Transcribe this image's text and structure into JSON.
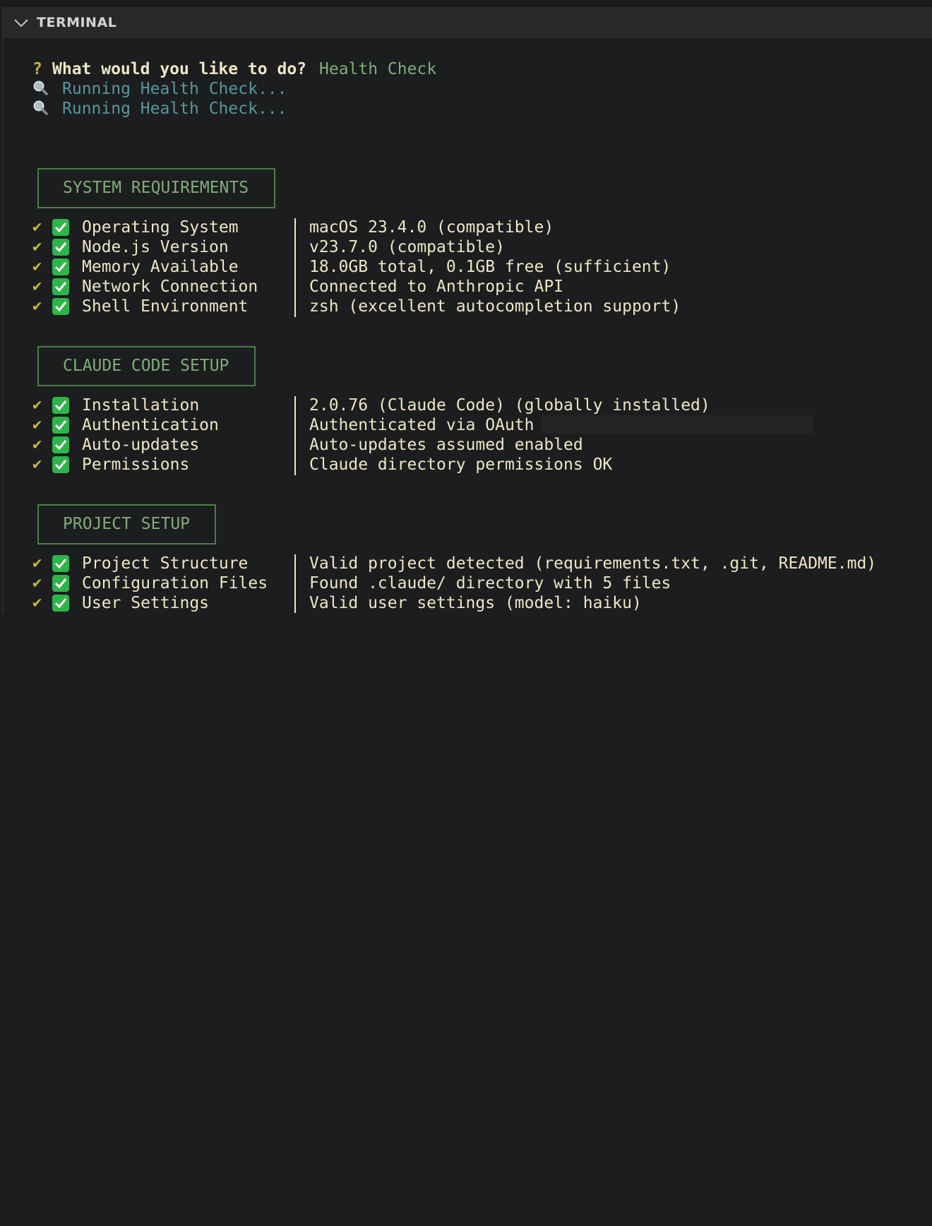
{
  "panel": {
    "title": "TERMINAL"
  },
  "prompt": {
    "marker": "?",
    "question": "What would you like to do?",
    "answer": "Health Check"
  },
  "running": [
    "Running Health Check...",
    "Running Health Check..."
  ],
  "sections": [
    {
      "title": "SYSTEM REQUIREMENTS",
      "rows": [
        {
          "label": "Operating System",
          "value": "macOS 23.4.0 (compatible)"
        },
        {
          "label": "Node.js Version",
          "value": "v23.7.0 (compatible)"
        },
        {
          "label": "Memory Available",
          "value": "18.0GB total, 0.1GB free (sufficient)"
        },
        {
          "label": "Network Connection",
          "value": "Connected to Anthropic API"
        },
        {
          "label": "Shell Environment",
          "value": "zsh (excellent autocompletion support)"
        }
      ]
    },
    {
      "title": "CLAUDE CODE SETUP",
      "rows": [
        {
          "label": "Installation",
          "value": "2.0.76 (Claude Code) (globally installed)"
        },
        {
          "label": "Authentication",
          "value": "Authenticated via OAuth"
        },
        {
          "label": "Auto-updates",
          "value": "Auto-updates assumed enabled"
        },
        {
          "label": "Permissions",
          "value": "Claude directory permissions OK"
        }
      ]
    },
    {
      "title": "PROJECT SETUP",
      "rows": [
        {
          "label": "Project Structure",
          "value": "Valid project detected (requirements.txt, .git, README.md)"
        },
        {
          "label": "Configuration Files",
          "value": "Found .claude/ directory with 5 files"
        },
        {
          "label": "User Settings",
          "value": "Valid user settings (model: haiku)"
        }
      ]
    }
  ],
  "status_marks": {
    "check": "✔",
    "pass_icon": "white-check-mark-icon"
  },
  "colors": {
    "background": "#1c1d1e",
    "header": "#262829",
    "text": "#eee6c4",
    "green": "#7fad79",
    "cyan": "#56989f",
    "yellow": "#c8b93a",
    "checkbox": "#2fb34c"
  }
}
